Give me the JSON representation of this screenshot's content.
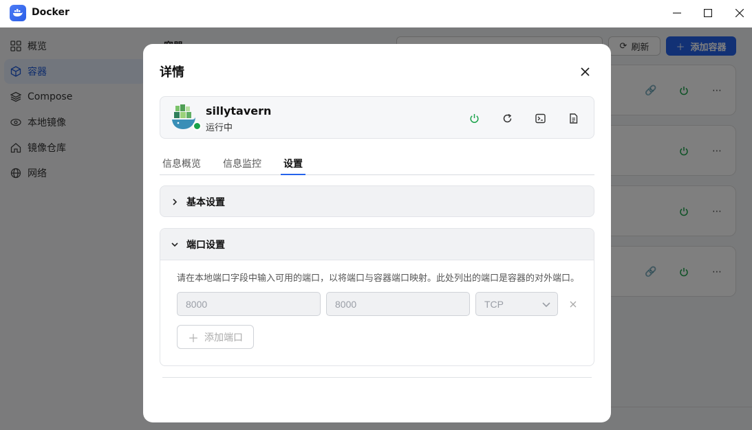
{
  "window": {
    "title": "Docker"
  },
  "sidebar": {
    "items": [
      {
        "label": "概览",
        "icon": "grid-icon"
      },
      {
        "label": "容器",
        "icon": "cube-icon",
        "active": true
      },
      {
        "label": "Compose",
        "icon": "layers-icon"
      },
      {
        "label": "本地镜像",
        "icon": "eye-icon"
      },
      {
        "label": "镜像仓库",
        "icon": "home-icon"
      },
      {
        "label": "网络",
        "icon": "globe-icon"
      }
    ]
  },
  "main": {
    "title": "容器",
    "refresh_label": "刷新",
    "add_container_label": "添加容器"
  },
  "modal": {
    "title": "详情",
    "container": {
      "name": "sillytavern",
      "status": "运行中",
      "status_color": "#1aa34a"
    },
    "tabs": [
      {
        "label": "信息概览"
      },
      {
        "label": "信息监控"
      },
      {
        "label": "设置",
        "active": true
      }
    ],
    "sections": {
      "basic": {
        "label": "基本设置",
        "expanded": false
      },
      "ports": {
        "label": "端口设置",
        "expanded": true,
        "hint": "请在本地端口字段中输入可用的端口，以将端口与容器端口映射。此处列出的端口是容器的对外端口。",
        "rows": [
          {
            "host_port": "8000",
            "container_port": "8000",
            "protocol": "TCP"
          }
        ],
        "add_port_label": "添加端口"
      }
    }
  },
  "colors": {
    "accent": "#2563eb",
    "power_green": "#1aa34a"
  }
}
